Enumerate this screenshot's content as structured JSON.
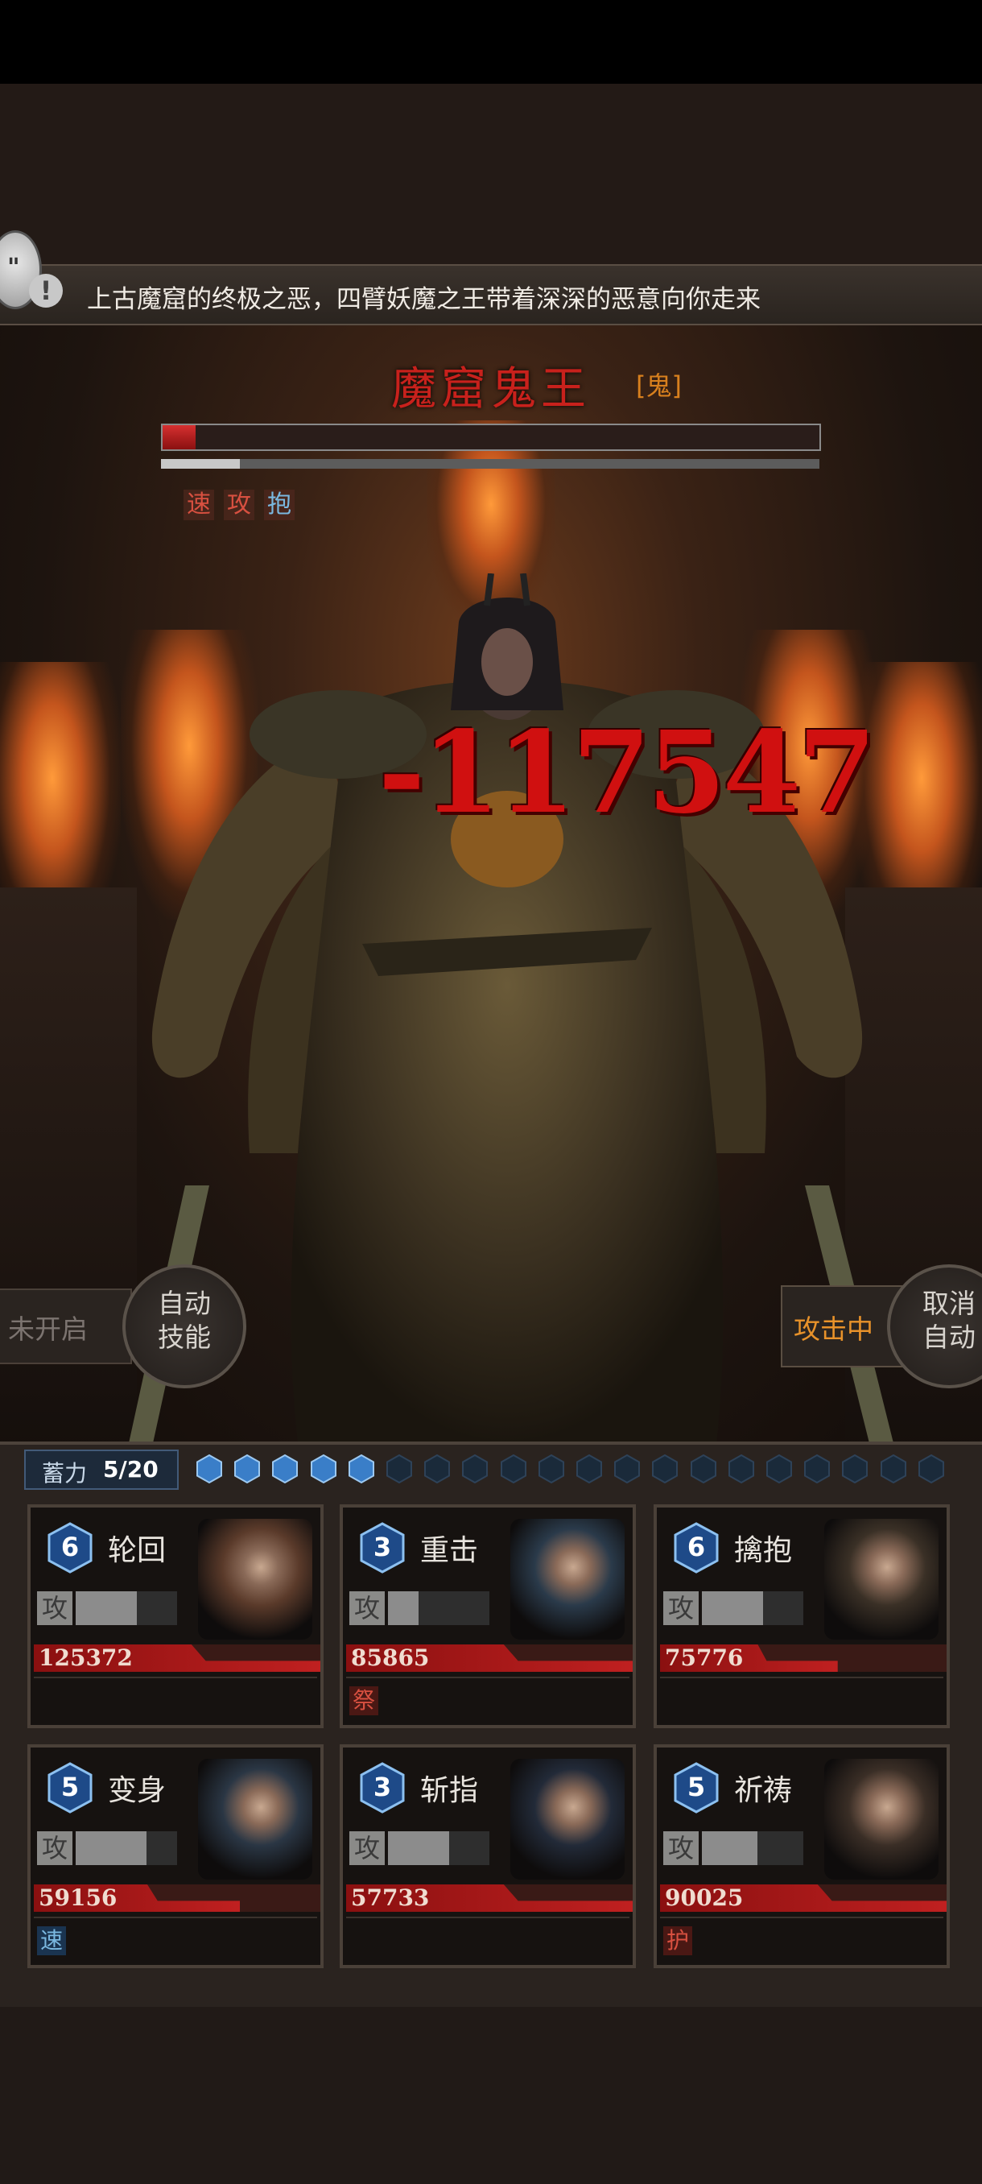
{
  "message": {
    "text": "上古魔窟的终极之恶，四臂妖魔之王带着深深的恶意向你走来",
    "chat_icon": "speech-bubble-icon",
    "alert_icon": "exclamation-icon",
    "chat_symbol": "\"",
    "alert_symbol": "!"
  },
  "boss": {
    "name": "魔窟鬼王",
    "type_tag": "[鬼]",
    "hp_fraction": 0.05,
    "secondary_fraction": 0.12,
    "status_tags": [
      {
        "label": "速",
        "color": "#d85040"
      },
      {
        "label": "攻",
        "color": "#d85040"
      },
      {
        "label": "抱",
        "color": "#7ab8e0"
      }
    ],
    "damage_text": "-117547"
  },
  "controls": {
    "left_slot": "未开启",
    "auto_skill": [
      "自动",
      "技能"
    ],
    "attack_status": "攻击中",
    "cancel_auto": [
      "取消",
      "自动"
    ]
  },
  "charge": {
    "label": "蓄力",
    "value": "5/20",
    "filled": 5,
    "total": 20
  },
  "cards": [
    {
      "level": "6",
      "skill": "轮回",
      "atk_label": "攻",
      "atk_fraction": 0.6,
      "hp": "125372",
      "hp_fraction": 1.0,
      "status": "",
      "status_color": "",
      "portrait": "bald-monk-portrait"
    },
    {
      "level": "3",
      "skill": "重击",
      "atk_label": "攻",
      "atk_fraction": 0.3,
      "hp": "85865",
      "hp_fraction": 1.0,
      "status": "祭",
      "status_color": "#d85040",
      "portrait": "young-man-portrait"
    },
    {
      "level": "6",
      "skill": "擒抱",
      "atk_label": "攻",
      "atk_fraction": 0.6,
      "hp": "75776",
      "hp_fraction": 0.62,
      "status": "",
      "status_color": "",
      "portrait": "old-man-portrait"
    },
    {
      "level": "5",
      "skill": "变身",
      "atk_label": "攻",
      "atk_fraction": 0.7,
      "hp": "59156",
      "hp_fraction": 0.72,
      "status": "速",
      "status_color": "#7ab8e0",
      "portrait": "young-woman-portrait"
    },
    {
      "level": "3",
      "skill": "斩指",
      "atk_label": "攻",
      "atk_fraction": 0.6,
      "hp": "57733",
      "hp_fraction": 1.0,
      "status": "",
      "status_color": "",
      "portrait": "hooded-figure-portrait"
    },
    {
      "level": "5",
      "skill": "祈祷",
      "atk_label": "攻",
      "atk_fraction": 0.55,
      "hp": "90025",
      "hp_fraction": 1.0,
      "status": "护",
      "status_color": "#d85040",
      "portrait": "woman-bangs-portrait"
    }
  ]
}
